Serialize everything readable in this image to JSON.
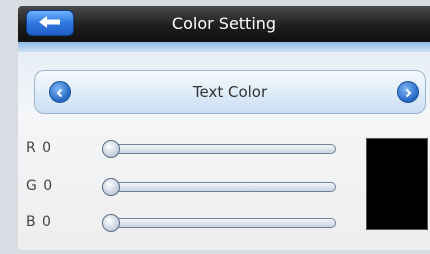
{
  "header": {
    "title": "Color Setting",
    "back_icon": "back-arrow-icon"
  },
  "selector": {
    "label": "Text Color",
    "prev_icon": "chevron-left-icon",
    "next_icon": "chevron-right-icon"
  },
  "sliders": [
    {
      "label": "R 0",
      "value": 0
    },
    {
      "label": "G 0",
      "value": 0
    },
    {
      "label": "B 0",
      "value": 0
    }
  ],
  "preview": {
    "color": "#000000"
  },
  "colors": {
    "header_bg": "#1e1e1e",
    "accent_blue": "#2f78e0",
    "screen_bg": "#ececec"
  }
}
